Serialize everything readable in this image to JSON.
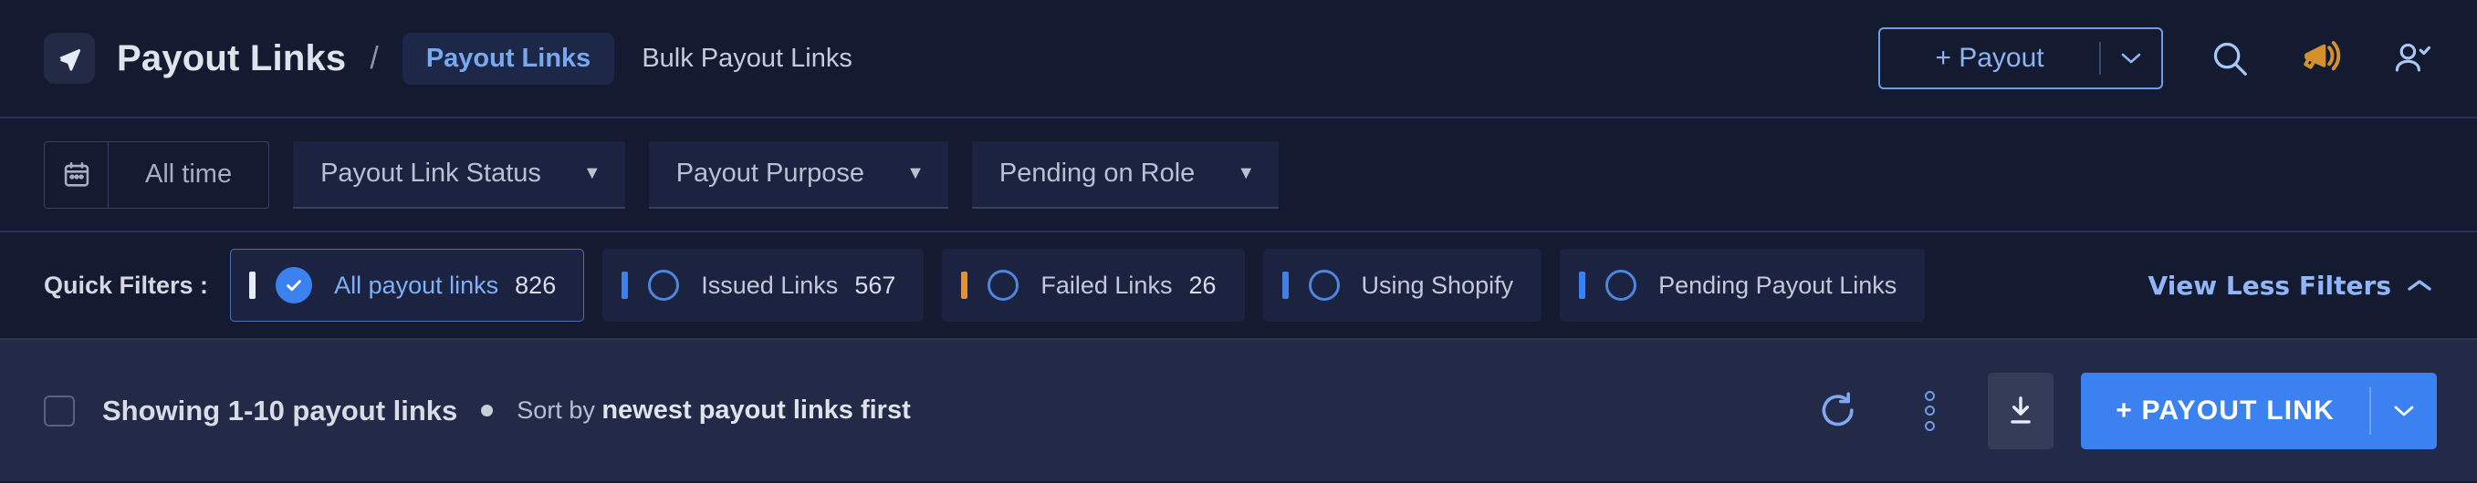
{
  "header": {
    "brand_icon": "send-icon",
    "title": "Payout Links",
    "separator": "/",
    "tabs": [
      {
        "label": "Payout Links",
        "active": true
      },
      {
        "label": "Bulk Payout Links",
        "active": false
      }
    ],
    "payout_button": {
      "label": "+ Payout",
      "caret": "⌄"
    },
    "icons": [
      "search-icon",
      "megaphone-icon",
      "user-account-icon"
    ],
    "accent_blue": "#6f9ce8",
    "megaphone_color": "#d4912b"
  },
  "filters": {
    "date_range": {
      "icon": "calendar-icon",
      "value": "All time"
    },
    "dropdowns": [
      {
        "label": "Payout Link Status",
        "caret": "▼"
      },
      {
        "label": "Payout Purpose",
        "caret": "▼"
      },
      {
        "label": "Pending on Role",
        "caret": "▼"
      }
    ]
  },
  "quick_filters": {
    "label": "Quick Filters :",
    "chips": [
      {
        "label": "All payout links",
        "count": "826",
        "selected": true,
        "accent": "#e8ecf6"
      },
      {
        "label": "Issued Links",
        "count": "567",
        "selected": false,
        "accent": "#3b82f0"
      },
      {
        "label": "Failed Links",
        "count": "26",
        "selected": false,
        "accent": "#e8902a"
      },
      {
        "label": "Using Shopify",
        "count": "",
        "selected": false,
        "accent": "#3b82f0"
      },
      {
        "label": "Pending Payout Links",
        "count": "",
        "selected": false,
        "accent": "#3b82f0"
      }
    ],
    "view_toggle": {
      "label": "View Less Filters",
      "chevron": "chevron-up-icon"
    }
  },
  "bottom_bar": {
    "select_all": "select-all-checkbox",
    "showing": "Showing 1-10 payout links",
    "sort_prefix": "Sort by ",
    "sort_value": "newest payout links first",
    "actions": [
      "refresh-icon",
      "more-options-icon",
      "download-icon"
    ],
    "primary_button": {
      "label": "+ PAYOUT LINK",
      "caret": "⌄",
      "color": "#3b82f0"
    }
  }
}
